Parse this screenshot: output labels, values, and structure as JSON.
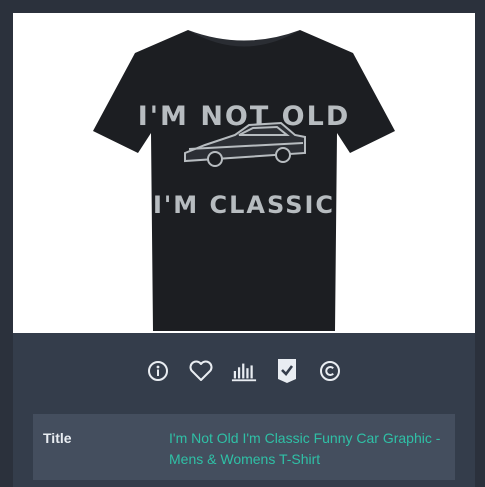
{
  "product": {
    "image": {
      "shirt_text_top": "I'M NOT OLD",
      "shirt_text_bottom": "I'M CLASSIC",
      "shirt_color": "#1c1e22"
    },
    "actions": [
      {
        "name": "info",
        "icon": "info-icon"
      },
      {
        "name": "favorite",
        "icon": "heart-icon"
      },
      {
        "name": "stats",
        "icon": "bar-chart-icon"
      },
      {
        "name": "check",
        "icon": "check-badge-icon"
      },
      {
        "name": "copyright",
        "icon": "copyright-icon"
      }
    ],
    "details": {
      "title_label": "Title",
      "title_value": "I'm Not Old I'm Classic Funny Car Graphic - Mens & Womens T-Shirt"
    }
  },
  "colors": {
    "page_background": "#2b313c",
    "panel_background": "#343d4b",
    "row_background": "#444e5e",
    "accent": "#2fc0a6",
    "icon": "#e9edf2"
  }
}
